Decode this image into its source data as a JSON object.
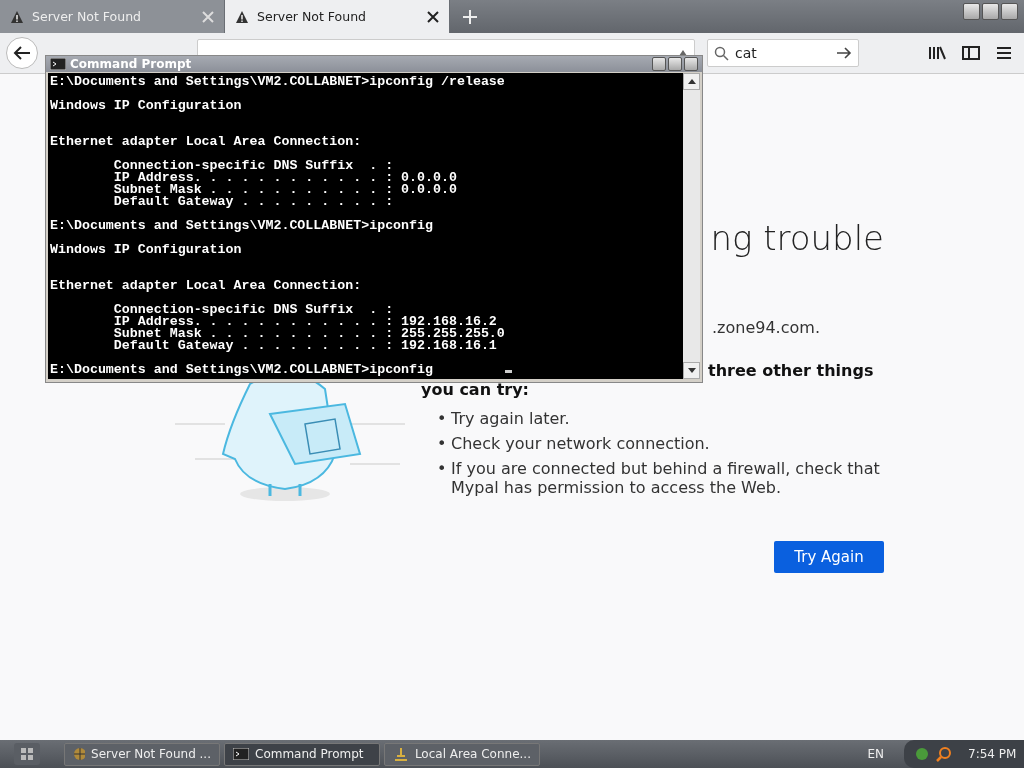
{
  "browser": {
    "tabs": [
      {
        "title": "Server Not Found",
        "selected": false
      },
      {
        "title": "Server Not Found",
        "selected": true
      }
    ],
    "search": {
      "value": "cat"
    }
  },
  "page": {
    "heading": "ng trouble",
    "address_text": ".zone94.com.",
    "suggestion_lines": [
      "three other things",
      "you can try:"
    ],
    "items": [
      "Try again later.",
      "Check your network connection.",
      "If you are connected but behind a firewall, check that Mypal has permission to access the Web."
    ],
    "bullet": "•",
    "button": "Try Again"
  },
  "console_window": {
    "title": "Command Prompt",
    "output": "E:\\Documents and Settings\\VM2.COLLABNET>ipconfig /release\n\nWindows IP Configuration\n\n\nEthernet adapter Local Area Connection:\n\n        Connection-specific DNS Suffix  . :\n        IP Address. . . . . . . . . . . . : 0.0.0.0\n        Subnet Mask . . . . . . . . . . . : 0.0.0.0\n        Default Gateway . . . . . . . . . :\n\nE:\\Documents and Settings\\VM2.COLLABNET>ipconfig\n\nWindows IP Configuration\n\n\nEthernet adapter Local Area Connection:\n\n        Connection-specific DNS Suffix  . :\n        IP Address. . . . . . . . . . . . : 192.168.16.2\n        Subnet Mask . . . . . . . . . . . : 255.255.255.0\n        Default Gateway . . . . . . . . . : 192.168.16.1\n\nE:\\Documents and Settings\\VM2.COLLABNET>ipconfig"
  },
  "taskbar": {
    "tasks": [
      {
        "label": "Server Not Found ...",
        "kind": "browser",
        "selected": false
      },
      {
        "label": "Command Prompt",
        "kind": "console",
        "selected": true
      },
      {
        "label": "Local Area Conne...",
        "kind": "network",
        "selected": false
      }
    ],
    "language": "EN",
    "clock": "7:54 PM"
  }
}
